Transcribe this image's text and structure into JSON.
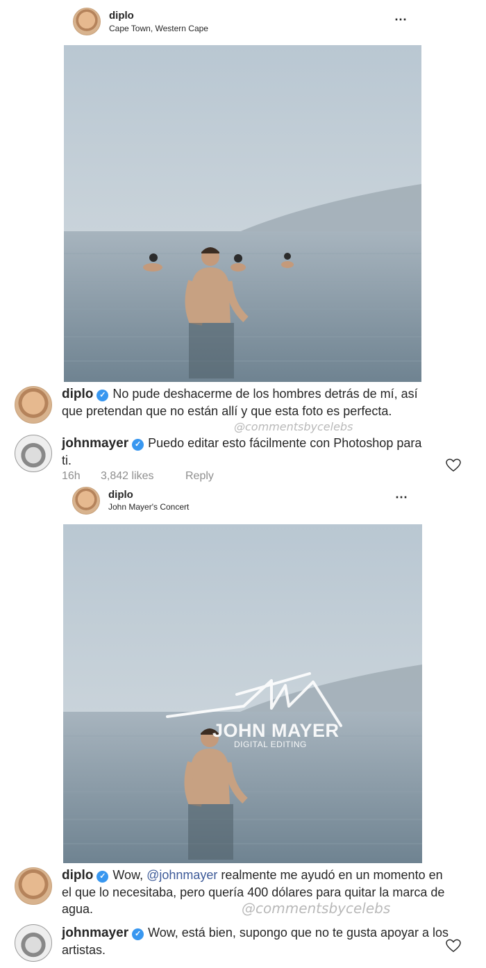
{
  "post1": {
    "username": "diplo",
    "location": "Cape Town, Western Cape",
    "more_icon": "⋯"
  },
  "comment1": {
    "username": "diplo",
    "text": "No pude deshacerme de los hombres detrás de mí, así que pretendan que no están allí y que esta foto es perfecta.",
    "watermark": "@commentsbycelebs"
  },
  "comment2": {
    "username": "johnmayer",
    "text": "Puedo editar esto fácilmente con Photoshop para ti.",
    "time": "16h",
    "likes": "3,842 likes",
    "reply": "Reply"
  },
  "post2": {
    "username": "diplo",
    "location": "John Mayer's Concert",
    "more_icon": "⋯",
    "overlay_brand": "JOHN MAYER",
    "overlay_sub": "DIGITAL EDITING"
  },
  "comment3": {
    "username": "diplo",
    "text_before": "Wow, ",
    "mention": "@johnmayer",
    "text_after": " realmente me ayudó en un momento en el que lo necesitaba, pero quería 400 dólares para quitar la marca de agua.",
    "watermark": "@commentsbycelebs"
  },
  "comment4": {
    "username": "johnmayer",
    "text": "Wow, está bien, supongo que no te gusta apoyar a los artistas."
  },
  "colors": {
    "verified": "#3897f0",
    "mention": "#3d5a98",
    "meta": "#8e8e8e"
  },
  "icons": [
    "verified-badge-icon",
    "heart-icon",
    "more-options-icon"
  ]
}
